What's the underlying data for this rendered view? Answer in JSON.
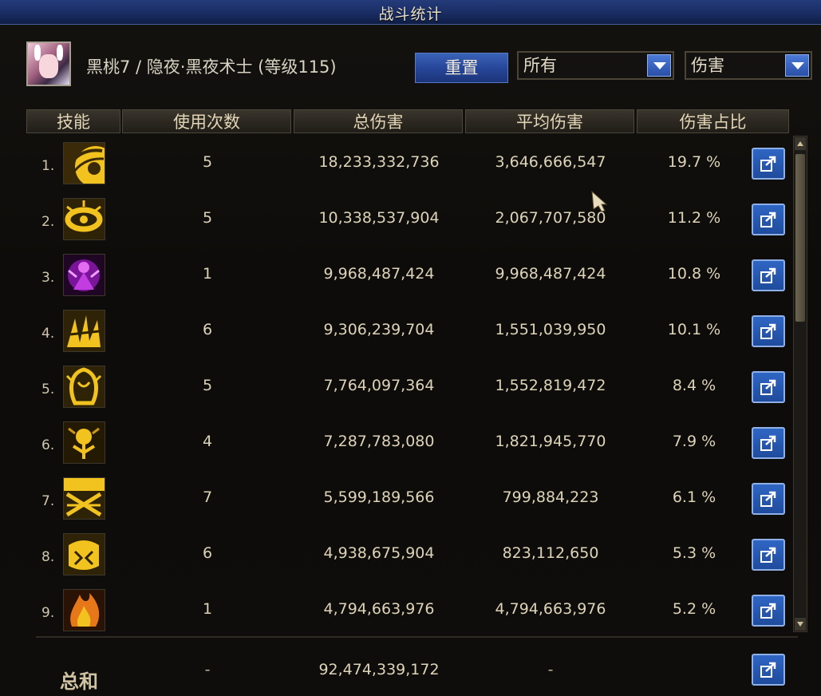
{
  "window": {
    "title": "战斗统计"
  },
  "character": {
    "name": "黑桃7 / 隐夜·黑夜术士 (等级115)"
  },
  "controls": {
    "reset_label": "重置",
    "filter_select": "所有",
    "metric_select": "伤害"
  },
  "table": {
    "headers": [
      "技能",
      "使用次数",
      "总伤害",
      "平均伤害",
      "伤害占比"
    ],
    "rows": [
      {
        "rank": "1.",
        "uses": "5",
        "total": "18,233,332,736",
        "avg": "3,646,666,547",
        "pct": "19.7 %",
        "icon": "golden-arc-skill-icon"
      },
      {
        "rank": "2.",
        "uses": "5",
        "total": "10,338,537,904",
        "avg": "2,067,707,580",
        "pct": "11.2 %",
        "icon": "golden-ring-skill-icon"
      },
      {
        "rank": "3.",
        "uses": "1",
        "total": "9,968,487,424",
        "avg": "9,968,487,424",
        "pct": "10.8 %",
        "icon": "purple-figure-skill-icon"
      },
      {
        "rank": "4.",
        "uses": "6",
        "total": "9,306,239,704",
        "avg": "1,551,039,950",
        "pct": "10.1 %",
        "icon": "golden-claws-skill-icon"
      },
      {
        "rank": "5.",
        "uses": "5",
        "total": "7,764,097,364",
        "avg": "1,552,819,472",
        "pct": "8.4 %",
        "icon": "golden-face-skill-icon"
      },
      {
        "rank": "6.",
        "uses": "4",
        "total": "7,287,783,080",
        "avg": "1,821,945,770",
        "pct": "7.9 %",
        "icon": "golden-tree-skill-icon"
      },
      {
        "rank": "7.",
        "uses": "7",
        "total": "5,599,189,566",
        "avg": "799,884,223",
        "pct": "6.1 %",
        "icon": "golden-cross-skill-icon"
      },
      {
        "rank": "8.",
        "uses": "6",
        "total": "4,938,675,904",
        "avg": "823,112,650",
        "pct": "5.3 %",
        "icon": "golden-beast-skill-icon"
      },
      {
        "rank": "9.",
        "uses": "1",
        "total": "4,794,663,976",
        "avg": "4,794,663,976",
        "pct": "5.2 %",
        "icon": "orange-flame-skill-icon"
      }
    ]
  },
  "summary": {
    "label": "总和",
    "uses": "-",
    "total": "92,474,339,172",
    "avg": "-"
  },
  "colors": {
    "title_bar": "#1a2d63",
    "button_blue": "#28479a",
    "text_gold": "#ddd3b8",
    "skill_gold": "#e8b21c",
    "skill_purple": "#a021c8"
  }
}
